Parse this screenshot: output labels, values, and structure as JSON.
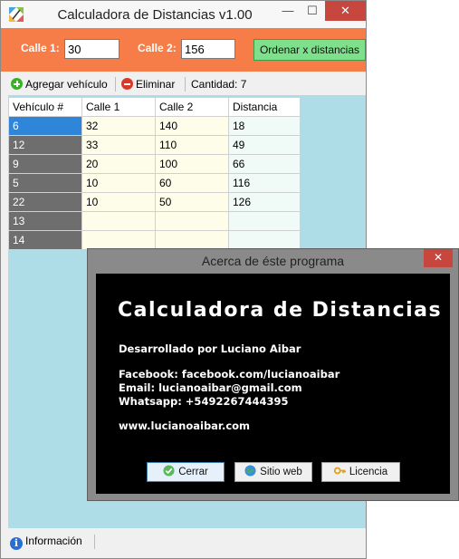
{
  "window": {
    "title": "Calculadora de Distancias v1.00",
    "minimize": "—",
    "maximize": "☐",
    "close": "✕"
  },
  "inputs": {
    "calle1_label": "Calle 1:",
    "calle1_value": "30",
    "calle2_label": "Calle 2:",
    "calle2_value": "156",
    "order_button": "Ordenar x distancias"
  },
  "toolbar": {
    "add_label": "Agregar vehículo",
    "delete_label": "Eliminar",
    "count_label": "Cantidad: 7"
  },
  "table": {
    "columns": [
      "Vehículo #",
      "Calle 1",
      "Calle 2",
      "Distancia"
    ],
    "rows": [
      [
        "6",
        "32",
        "140",
        "18"
      ],
      [
        "12",
        "33",
        "110",
        "49"
      ],
      [
        "9",
        "20",
        "100",
        "66"
      ],
      [
        "5",
        "10",
        "60",
        "116"
      ],
      [
        "22",
        "10",
        "50",
        "126"
      ],
      [
        "13",
        "",
        "",
        ""
      ],
      [
        "14",
        "",
        "",
        ""
      ]
    ]
  },
  "statusbar": {
    "info_label": "Información"
  },
  "dialog": {
    "title": "Acerca de éste programa",
    "close": "✕",
    "heading": "Calculadora de Distancias",
    "developer": "Desarrollado por Luciano Aibar",
    "facebook": "Facebook: facebook.com/lucianoaibar",
    "email": "Email: lucianoaibar@gmail.com",
    "whatsapp": "Whatsapp: +5492267444395",
    "website": "www.lucianoaibar.com",
    "btn_close": "Cerrar",
    "btn_web": "Sitio web",
    "btn_license": "Licencia"
  },
  "icons": {
    "app": "app-icon",
    "add": "add-icon",
    "delete": "delete-icon",
    "info": "info-icon",
    "check": "check-icon",
    "globe": "globe-icon",
    "key": "key-icon"
  },
  "colors": {
    "header_band": "#f77d48",
    "order_button": "#7fe08c",
    "grid_background": "#aedde8",
    "row_header": "#6e6e6e",
    "selected_row_header": "#2f86d9",
    "close_button": "#c7463e",
    "dialog_body": "#000000"
  }
}
